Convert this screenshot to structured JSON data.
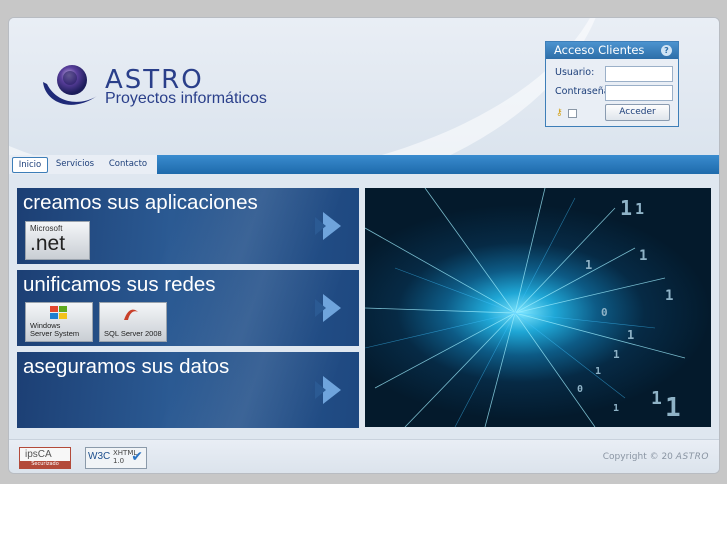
{
  "logo": {
    "name": "ASTRO",
    "tagline": "Proyectos informáticos"
  },
  "login": {
    "title": "Acceso Clientes",
    "help_icon": "help-icon",
    "user_label": "Usuario:",
    "password_label": "Contraseña:",
    "user_value": "",
    "password_value": "",
    "submit_label": "Acceder"
  },
  "nav": {
    "items": [
      {
        "label": "Inicio"
      },
      {
        "label": "Servicios"
      },
      {
        "label": "Contacto"
      }
    ]
  },
  "banners": [
    {
      "title": "creamos sus aplicaciones",
      "logo_lines": [
        "Microsoft",
        ".net"
      ]
    },
    {
      "title": "unificamos sus redes",
      "products": [
        [
          "Windows",
          "Server System"
        ],
        [
          "SQL Server 2008"
        ]
      ]
    },
    {
      "title": "aseguramos sus datos"
    }
  ],
  "photo": {
    "digits": [
      "1",
      "1",
      "1",
      "1",
      "1",
      "0",
      "1",
      "1",
      "1",
      "0",
      "1",
      "1",
      "1"
    ]
  },
  "footer": {
    "badge_ipsca": {
      "name": "ipsCA",
      "sub": "Securizado"
    },
    "badge_w3c": {
      "logo": "W3C",
      "line1": "XHTML",
      "line2": "1.0"
    },
    "copyright": "Copyright © 20",
    "brand": "ASTRO"
  },
  "colors": {
    "accent": "#1e6aab",
    "brand": "#2a3f8a",
    "banner": "#2b5a93"
  }
}
